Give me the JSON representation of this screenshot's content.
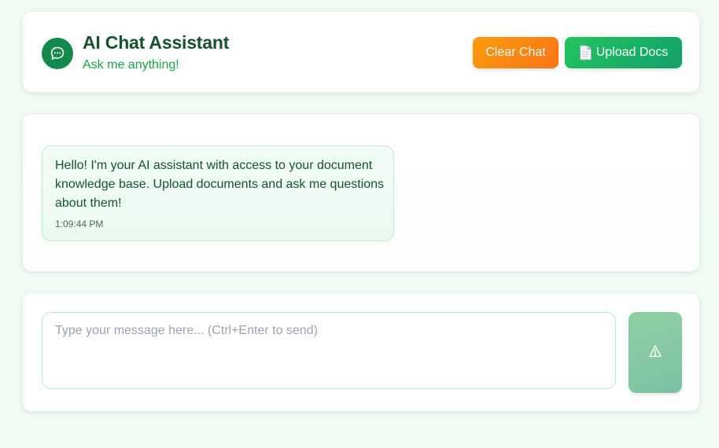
{
  "header": {
    "icon": "chat-bubble-icon",
    "title": "AI Chat Assistant",
    "subtitle": "Ask me anything!",
    "clear_label": "Clear Chat",
    "upload_label": "Upload Docs",
    "upload_icon": "document-icon"
  },
  "messages": [
    {
      "role": "assistant",
      "text": "Hello! I'm your AI assistant with access to your document knowledge base. Upload documents and ask me questions about them!",
      "time": "1:09:44 PM"
    }
  ],
  "composer": {
    "placeholder": "Type your message here... (Ctrl+Enter to send)",
    "value": "",
    "send_icon": "send-icon"
  },
  "colors": {
    "brand_dark": "#14532d",
    "brand": "#16a34a",
    "clear_button": "#f97316",
    "upload_button": "#22c55e",
    "page_background": "#f0fbf4"
  }
}
